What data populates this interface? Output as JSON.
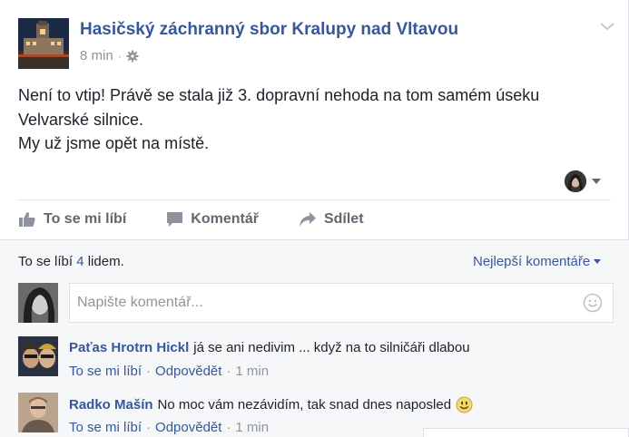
{
  "post": {
    "page_name": "Hasičský záchranný sbor Kralupy nad Vltavou",
    "time": "8 min",
    "meta_dot": "·",
    "privacy_icon": "gear-icon",
    "text_lines": [
      "Není to vtip! Právě se stala již 3. dopravní nehoda na tom samém úseku",
      "Velvarské silnice.",
      "My už jsme opět na místě."
    ]
  },
  "actions": {
    "like": "To se mi líbí",
    "comment": "Komentář",
    "share": "Sdílet"
  },
  "reactions": {
    "prefix": "To se líbí",
    "count": "4",
    "suffix": "lidem.",
    "sort_label": "Nejlepší komentáře"
  },
  "composer": {
    "placeholder": "Napište komentář..."
  },
  "comments": [
    {
      "author": "Paťas Hrotrn Hickl",
      "text": "já se ani nedivim ... když na to silničáři dlabou",
      "like": "To se mi líbí",
      "reply": "Odpovědět",
      "time": "1 min",
      "dot": "·"
    },
    {
      "author": "Radko Mašín",
      "text": "No moc vám nezávidím, tak snad dnes naposled",
      "like": "To se mi líbí",
      "reply": "Odpovědět",
      "time": "1 min",
      "dot": "·"
    }
  ],
  "colors": {
    "link": "#365899",
    "muted": "#90949c",
    "action": "#606770",
    "comments_bg": "#f6f7f9"
  }
}
